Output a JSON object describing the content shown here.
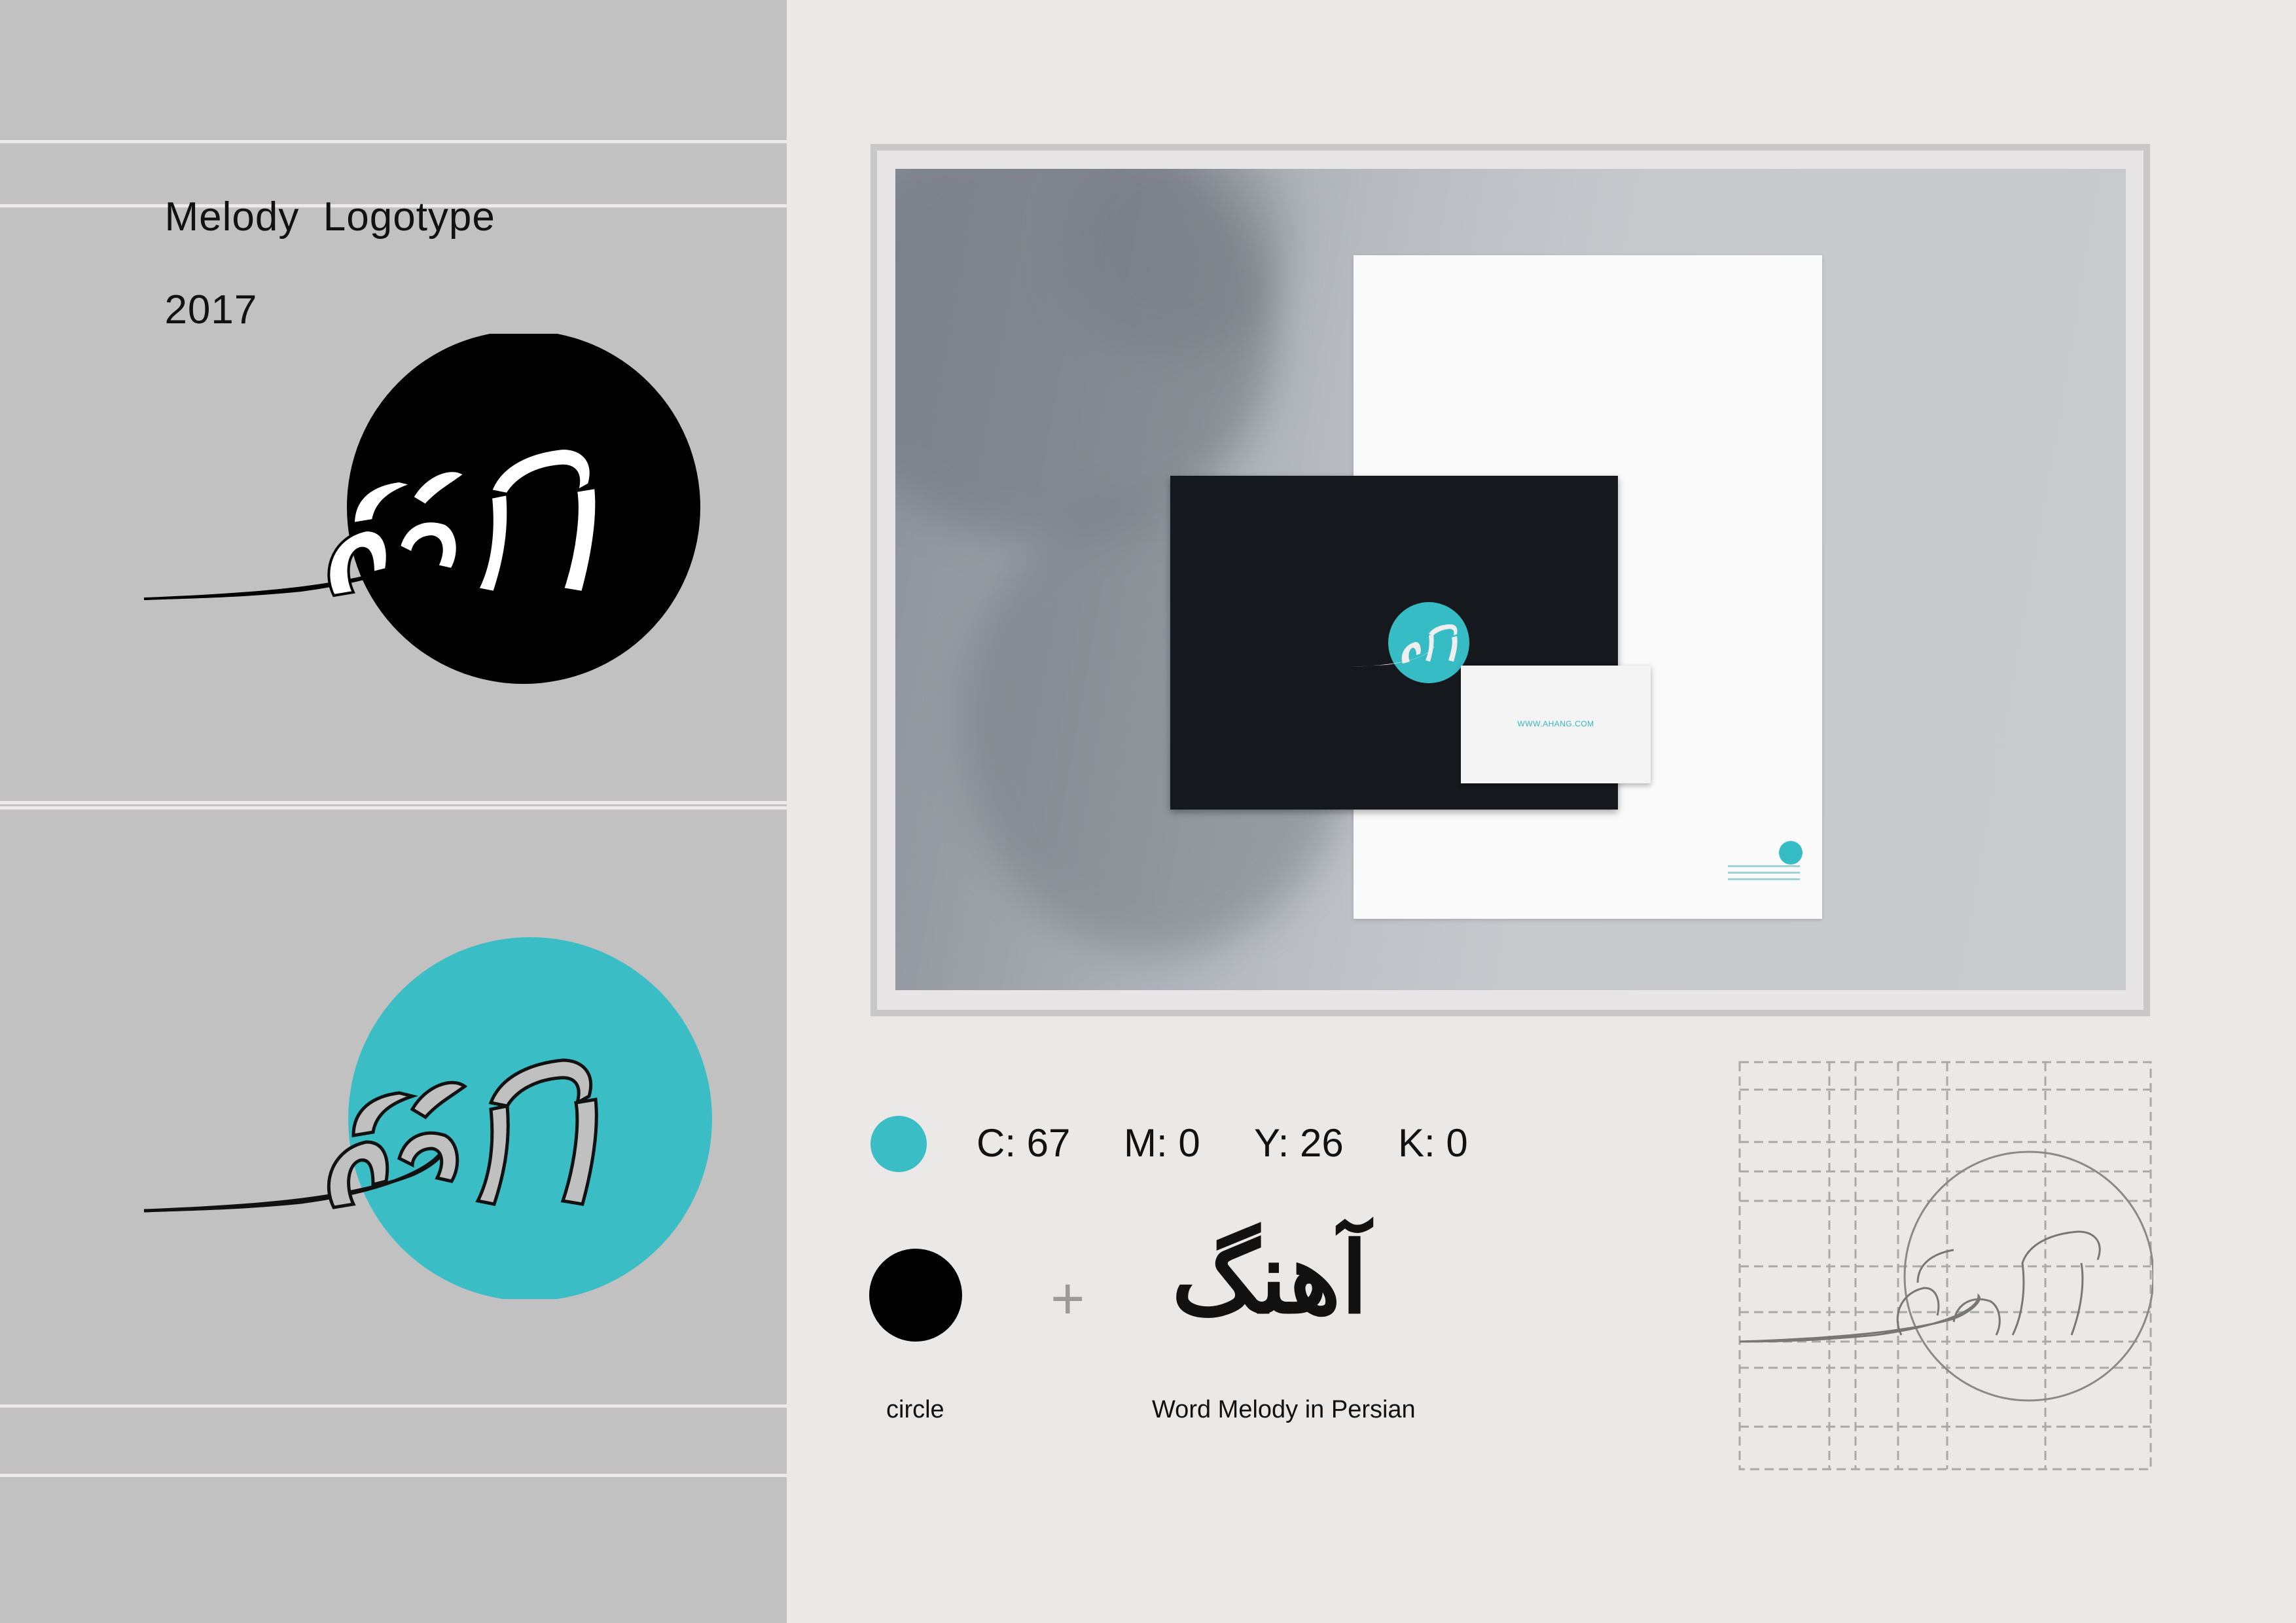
{
  "header": {
    "title": "Melody  Logotype",
    "year": "2017"
  },
  "logos": [
    {
      "name": "logo-black",
      "circle_color": "#000000",
      "mark_fill": "#ffffff"
    },
    {
      "name": "logo-teal",
      "circle_color": "#3bbdc5",
      "mark_fill": "#c0c0c0"
    }
  ],
  "mockup": {
    "business_card_url": "WWW.AHANG.COM",
    "accent_color": "#36bcc4"
  },
  "color_spec": {
    "swatch_color": "#3bbdc5",
    "c": "C: 67",
    "m": "M: 0",
    "y": "Y: 26",
    "k": "K: 0"
  },
  "construction": {
    "element_1_label": "circle",
    "plus_sign": "+",
    "persian_word": "آهنگ",
    "element_2_label": "Word Melody in Persian"
  },
  "colors": {
    "left_panel": "#c2c1c2",
    "page_background": "#ebe8e8",
    "teal": "#3bbdc5",
    "black": "#000000"
  }
}
